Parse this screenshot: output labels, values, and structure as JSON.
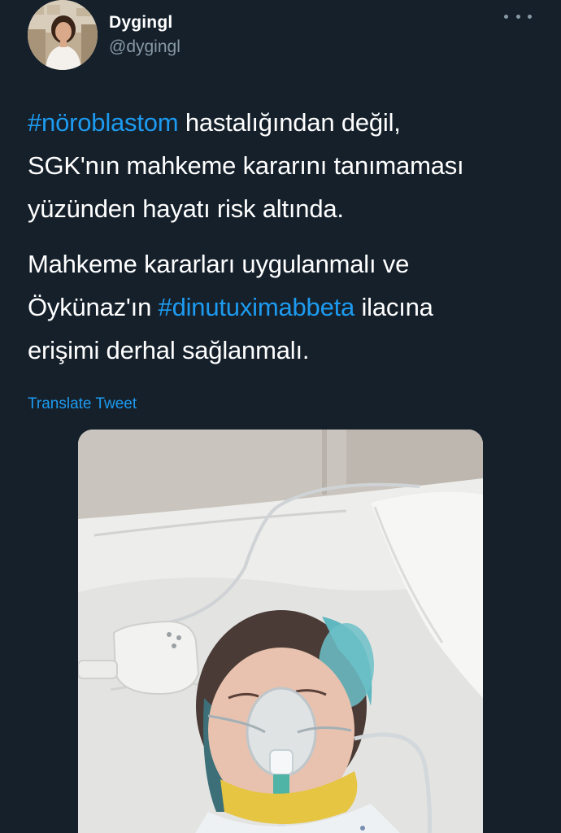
{
  "author": {
    "display_name": "Dygingl",
    "handle": "@dygingl",
    "avatar_icon": "profile-photo"
  },
  "menu": {
    "more_icon": "more-dots-icon"
  },
  "tweet": {
    "paragraph_1": {
      "hashtag": "#nöroblastom",
      "line_1_rest": " hastalığından değil,",
      "line_2": "SGK'nın mahkeme kararını tanımaması",
      "line_3": "yüzünden hayatı risk altında."
    },
    "paragraph_2": {
      "line_1": "Mahkeme kararları uygulanmalı ve",
      "line_2_before": "Öykünaz'ın ",
      "hashtag": "#dinutuximabbeta",
      "line_2_after": " ilacına",
      "line_3": "erişimi derhal sağlanmalı."
    }
  },
  "translate_label": "Translate Tweet",
  "colors": {
    "background": "#15202b",
    "link": "#1d9bf0",
    "secondary_text": "#8899a6"
  }
}
